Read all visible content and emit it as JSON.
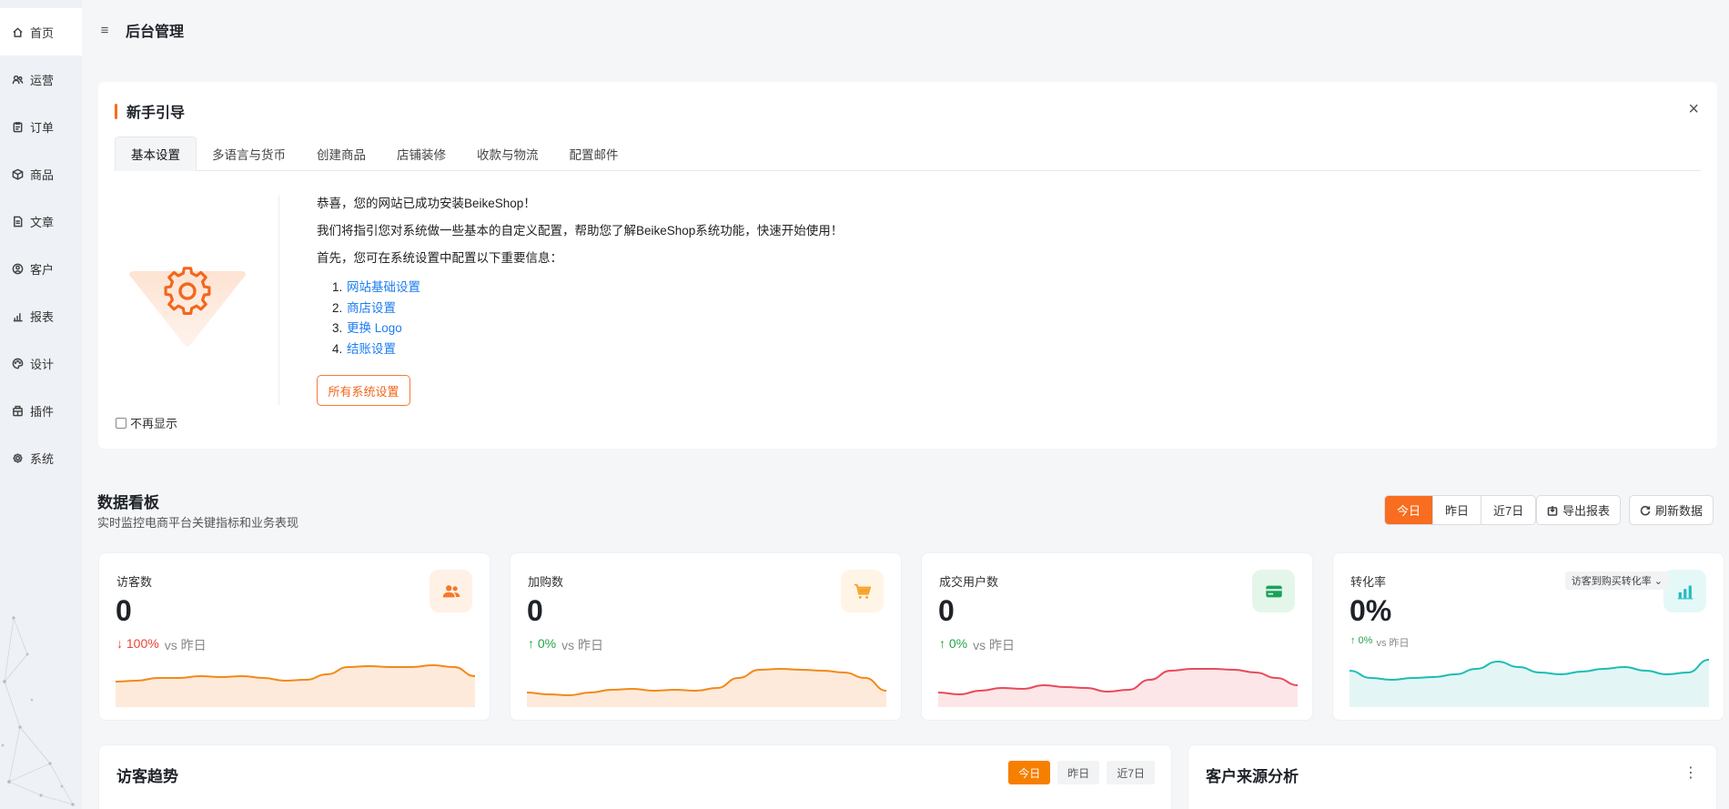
{
  "sidebar": {
    "items": [
      {
        "label": "首页",
        "icon": "home-icon"
      },
      {
        "label": "运营",
        "icon": "users-icon"
      },
      {
        "label": "订单",
        "icon": "clipboard-icon"
      },
      {
        "label": "商品",
        "icon": "box-icon"
      },
      {
        "label": "文章",
        "icon": "document-icon"
      },
      {
        "label": "客户",
        "icon": "user-circle-icon"
      },
      {
        "label": "报表",
        "icon": "bar-chart-icon"
      },
      {
        "label": "设计",
        "icon": "palette-icon"
      },
      {
        "label": "插件",
        "icon": "plugin-icon"
      },
      {
        "label": "系统",
        "icon": "gear-icon"
      }
    ]
  },
  "header": {
    "title": "后台管理"
  },
  "guide": {
    "title": "新手引导",
    "tabs": [
      "基本设置",
      "多语言与货币",
      "创建商品",
      "店铺装修",
      "收款与物流",
      "配置邮件"
    ],
    "line1": "恭喜，您的网站已成功安装BeikeShop！",
    "line2": "我们将指引您对系统做一些基本的自定义配置，帮助您了解BeikeShop系统功能，快速开始使用！",
    "line3": "首先，您可在系统设置中配置以下重要信息：",
    "links": [
      {
        "num": "1.",
        "label": "网站基础设置"
      },
      {
        "num": "2.",
        "label": "商店设置"
      },
      {
        "num": "3.",
        "label": "更换 Logo"
      },
      {
        "num": "4.",
        "label": "结账设置"
      }
    ],
    "button": "所有系统设置",
    "dont_show": "不再显示"
  },
  "dashboard": {
    "title": "数据看板",
    "subtitle": "实时监控电商平台关键指标和业务表现",
    "periods": [
      "今日",
      "昨日",
      "近7日"
    ],
    "export": "导出报表",
    "refresh": "刷新数据",
    "cards": [
      {
        "label": "访客数",
        "value": "0",
        "trend": "↓ 100%",
        "vs": "vs 昨日",
        "trend_color": "#e8453c",
        "icon": "users-icon",
        "icon_color": "#f5792a",
        "icon_bg": "#fff1e6",
        "line_color": "#f28a1a",
        "fill_color": "#fdeadb"
      },
      {
        "label": "加购数",
        "value": "0",
        "trend": "↑ 0%",
        "vs": "vs 昨日",
        "trend_color": "#22a447",
        "icon": "cart-icon",
        "icon_color": "#f5a32a",
        "icon_bg": "#fff5e6",
        "line_color": "#f28a1a",
        "fill_color": "#fdeadb"
      },
      {
        "label": "成交用户数",
        "value": "0",
        "trend": "↑ 0%",
        "vs": "vs 昨日",
        "trend_color": "#22a447",
        "icon": "credit-card-icon",
        "icon_color": "#19a25a",
        "icon_bg": "#e4f6ea",
        "line_color": "#e84b5a",
        "fill_color": "#fde6e8"
      },
      {
        "label": "转化率",
        "value": "0%",
        "trend": "↑ 0%",
        "vs": "vs 昨日",
        "trend_color": "#22a447",
        "icon": "chart-icon",
        "icon_color": "#22bcc0",
        "icon_bg": "#e5f8f8",
        "line_color": "#1cbdb5",
        "fill_color": "#e3f6f5",
        "select": "访客到购买转化率"
      }
    ]
  },
  "visitor_trend": {
    "title": "访客趋势",
    "periods": [
      "今日",
      "昨日",
      "近7日"
    ]
  },
  "customer_source": {
    "title": "客户来源分析"
  }
}
